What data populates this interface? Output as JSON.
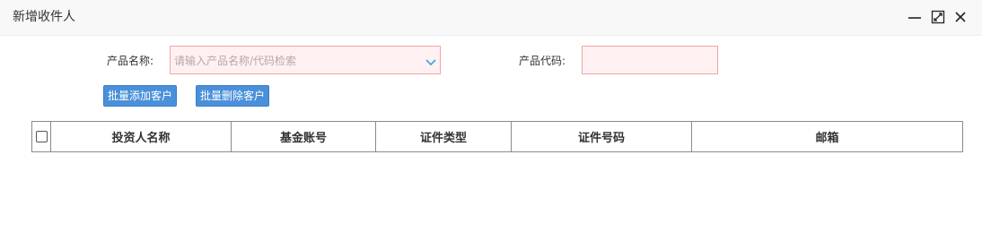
{
  "window": {
    "title": "新增收件人"
  },
  "form": {
    "product_name_label": "产品名称:",
    "product_name_placeholder": "请输入产品名称/代码检索",
    "product_code_label": "产品代码:",
    "product_code_value": ""
  },
  "actions": {
    "bulk_add_label": "批量添加客户",
    "bulk_delete_label": "批量删除客户"
  },
  "table": {
    "columns": [
      "投资人名称",
      "基金账号",
      "证件类型",
      "证件号码",
      "邮箱"
    ],
    "rows": []
  },
  "colors": {
    "primary_button": "#4a90d9",
    "error_border": "#f0a5a5",
    "error_fill": "#fff1f1",
    "caret": "#49a7e0"
  },
  "icons": [
    "minimize-icon",
    "maximize-icon",
    "close-icon",
    "chevron-down-icon"
  ]
}
